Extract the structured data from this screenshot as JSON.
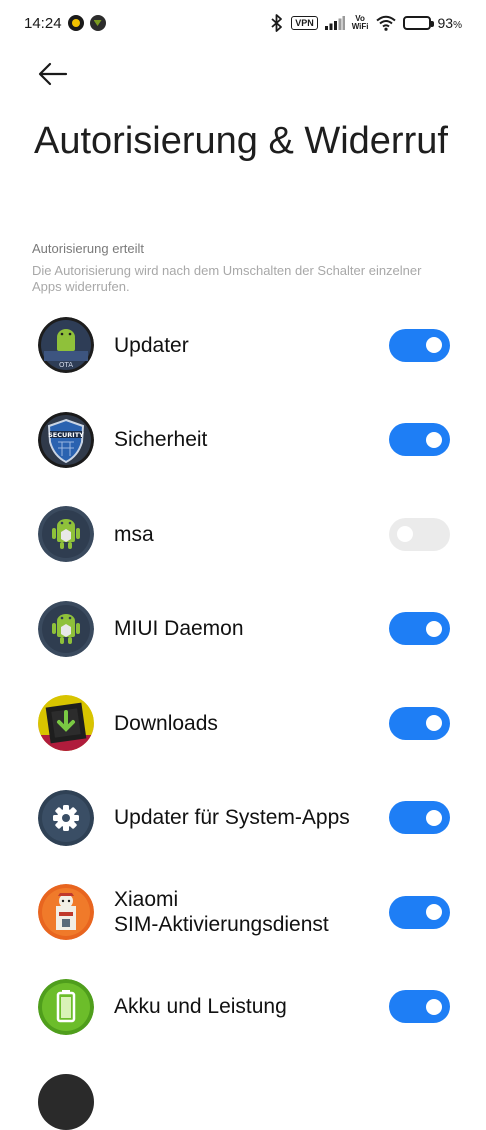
{
  "status_bar": {
    "time": "14:24",
    "vpn": "VPN",
    "vowifi_top": "Vo",
    "vowifi_bottom": "WiFi",
    "battery_percent": "93",
    "battery_level": 0.93
  },
  "header": {
    "back_icon": "arrow-left-icon",
    "title": "Autorisierung & Widerruf"
  },
  "section": {
    "heading": "Autorisierung erteilt",
    "description": "Die Autorisierung wird nach dem Umschalten der Schalter einzelner Apps widerrufen."
  },
  "apps": [
    {
      "name": "Updater",
      "icon": "ota-updater-icon",
      "enabled": true
    },
    {
      "name": "Sicherheit",
      "icon": "security-shield-icon",
      "enabled": true
    },
    {
      "name": "msa",
      "icon": "android-robot-icon",
      "enabled": false
    },
    {
      "name": "MIUI Daemon",
      "icon": "android-robot-icon",
      "enabled": true
    },
    {
      "name": "Downloads",
      "icon": "download-arrow-icon",
      "enabled": true
    },
    {
      "name": "Updater für System-Apps",
      "icon": "gear-icon",
      "enabled": true
    },
    {
      "name": "Xiaomi\nSIM-Aktivierungsdienst",
      "icon": "sim-activation-icon",
      "enabled": true
    },
    {
      "name": "Akku und Leistung",
      "icon": "battery-icon",
      "enabled": true
    }
  ],
  "colors": {
    "toggle_on": "#1e7ef5",
    "toggle_off": "#ebebeb"
  }
}
